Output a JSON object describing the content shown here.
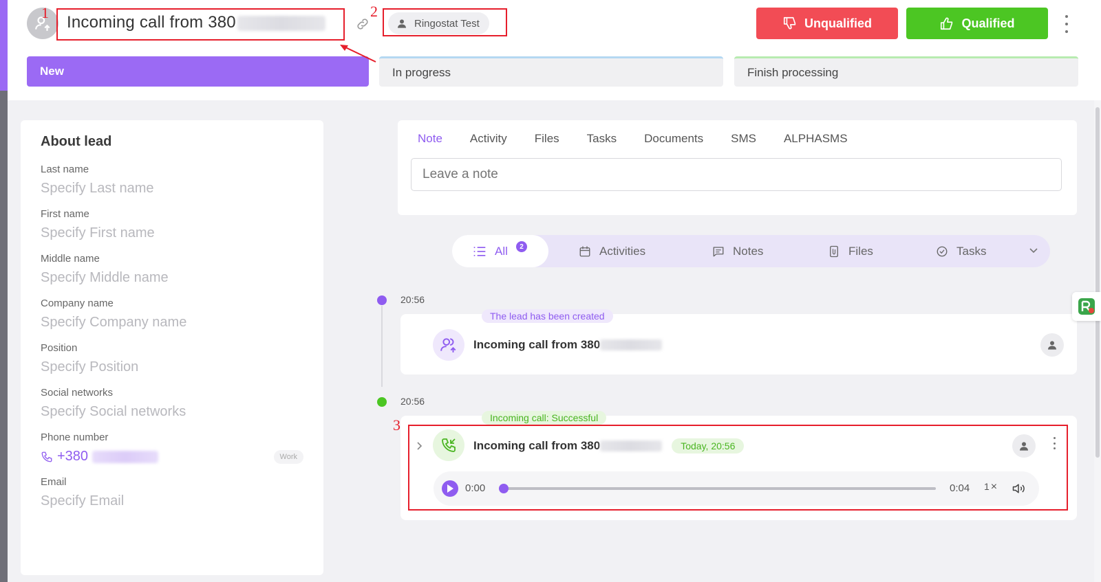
{
  "header": {
    "title_prefix": "Incoming call from 380",
    "user_chip": "Ringostat Test",
    "unqualified_label": "Unqualified",
    "qualified_label": "Qualified",
    "stages": {
      "new": "New",
      "in_progress": "In progress",
      "finish": "Finish processing"
    }
  },
  "annotations": {
    "n1": "1",
    "n2": "2",
    "n3": "3"
  },
  "about": {
    "title": "About lead",
    "fields": [
      {
        "label": "Last name",
        "placeholder": "Specify Last name"
      },
      {
        "label": "First name",
        "placeholder": "Specify First name"
      },
      {
        "label": "Middle name",
        "placeholder": "Specify Middle name"
      },
      {
        "label": "Company name",
        "placeholder": "Specify Company name"
      },
      {
        "label": "Position",
        "placeholder": "Specify Position"
      },
      {
        "label": "Social networks",
        "placeholder": "Specify Social networks"
      }
    ],
    "phone": {
      "label": "Phone number",
      "value": "+380",
      "tag": "Work"
    },
    "email": {
      "label": "Email",
      "placeholder": "Specify Email"
    }
  },
  "note_panel": {
    "tabs": [
      "Note",
      "Activity",
      "Files",
      "Tasks",
      "Documents",
      "SMS",
      "ALPHASMS"
    ],
    "placeholder": "Leave a note"
  },
  "filters": {
    "all": "All",
    "all_count": "2",
    "activities": "Activities",
    "notes": "Notes",
    "files": "Files",
    "tasks": "Tasks"
  },
  "timeline": [
    {
      "time": "20:56",
      "tag": "The lead has been created",
      "title_prefix": "Incoming call from 380",
      "dot_color": "#8f5cf0"
    },
    {
      "time": "20:56",
      "tag": "Incoming call: Successful",
      "title_prefix": "Incoming call from 380",
      "time_badge": "Today, 20:56",
      "dot_color": "#4cc623"
    }
  ],
  "player": {
    "current": "0:00",
    "duration": "0:04",
    "speed": "1",
    "progress": 0.0
  }
}
